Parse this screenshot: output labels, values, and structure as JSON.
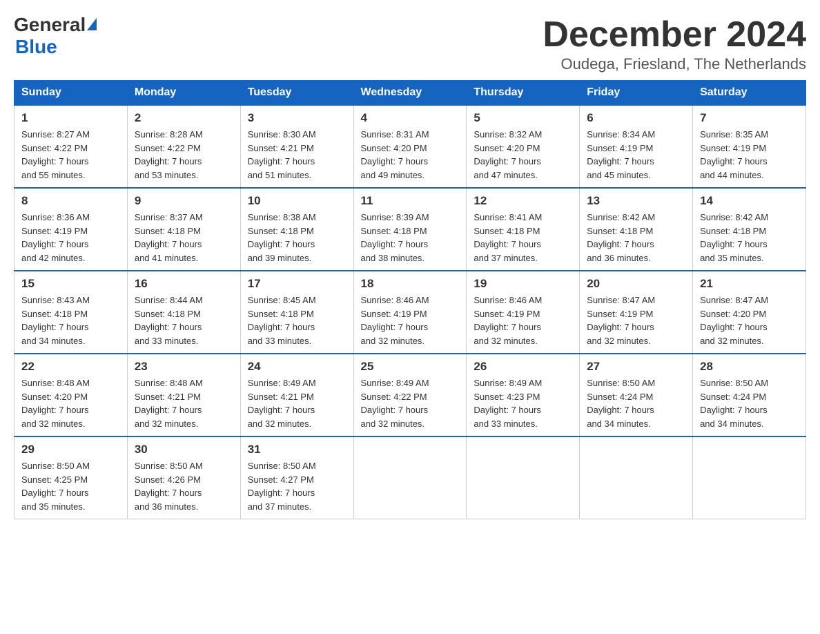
{
  "logo": {
    "text_general": "General",
    "text_blue": "Blue"
  },
  "title": "December 2024",
  "subtitle": "Oudega, Friesland, The Netherlands",
  "days_of_week": [
    "Sunday",
    "Monday",
    "Tuesday",
    "Wednesday",
    "Thursday",
    "Friday",
    "Saturday"
  ],
  "weeks": [
    [
      {
        "day": "1",
        "sunrise": "8:27 AM",
        "sunset": "4:22 PM",
        "daylight": "7 hours and 55 minutes."
      },
      {
        "day": "2",
        "sunrise": "8:28 AM",
        "sunset": "4:22 PM",
        "daylight": "7 hours and 53 minutes."
      },
      {
        "day": "3",
        "sunrise": "8:30 AM",
        "sunset": "4:21 PM",
        "daylight": "7 hours and 51 minutes."
      },
      {
        "day": "4",
        "sunrise": "8:31 AM",
        "sunset": "4:20 PM",
        "daylight": "7 hours and 49 minutes."
      },
      {
        "day": "5",
        "sunrise": "8:32 AM",
        "sunset": "4:20 PM",
        "daylight": "7 hours and 47 minutes."
      },
      {
        "day": "6",
        "sunrise": "8:34 AM",
        "sunset": "4:19 PM",
        "daylight": "7 hours and 45 minutes."
      },
      {
        "day": "7",
        "sunrise": "8:35 AM",
        "sunset": "4:19 PM",
        "daylight": "7 hours and 44 minutes."
      }
    ],
    [
      {
        "day": "8",
        "sunrise": "8:36 AM",
        "sunset": "4:19 PM",
        "daylight": "7 hours and 42 minutes."
      },
      {
        "day": "9",
        "sunrise": "8:37 AM",
        "sunset": "4:18 PM",
        "daylight": "7 hours and 41 minutes."
      },
      {
        "day": "10",
        "sunrise": "8:38 AM",
        "sunset": "4:18 PM",
        "daylight": "7 hours and 39 minutes."
      },
      {
        "day": "11",
        "sunrise": "8:39 AM",
        "sunset": "4:18 PM",
        "daylight": "7 hours and 38 minutes."
      },
      {
        "day": "12",
        "sunrise": "8:41 AM",
        "sunset": "4:18 PM",
        "daylight": "7 hours and 37 minutes."
      },
      {
        "day": "13",
        "sunrise": "8:42 AM",
        "sunset": "4:18 PM",
        "daylight": "7 hours and 36 minutes."
      },
      {
        "day": "14",
        "sunrise": "8:42 AM",
        "sunset": "4:18 PM",
        "daylight": "7 hours and 35 minutes."
      }
    ],
    [
      {
        "day": "15",
        "sunrise": "8:43 AM",
        "sunset": "4:18 PM",
        "daylight": "7 hours and 34 minutes."
      },
      {
        "day": "16",
        "sunrise": "8:44 AM",
        "sunset": "4:18 PM",
        "daylight": "7 hours and 33 minutes."
      },
      {
        "day": "17",
        "sunrise": "8:45 AM",
        "sunset": "4:18 PM",
        "daylight": "7 hours and 33 minutes."
      },
      {
        "day": "18",
        "sunrise": "8:46 AM",
        "sunset": "4:19 PM",
        "daylight": "7 hours and 32 minutes."
      },
      {
        "day": "19",
        "sunrise": "8:46 AM",
        "sunset": "4:19 PM",
        "daylight": "7 hours and 32 minutes."
      },
      {
        "day": "20",
        "sunrise": "8:47 AM",
        "sunset": "4:19 PM",
        "daylight": "7 hours and 32 minutes."
      },
      {
        "day": "21",
        "sunrise": "8:47 AM",
        "sunset": "4:20 PM",
        "daylight": "7 hours and 32 minutes."
      }
    ],
    [
      {
        "day": "22",
        "sunrise": "8:48 AM",
        "sunset": "4:20 PM",
        "daylight": "7 hours and 32 minutes."
      },
      {
        "day": "23",
        "sunrise": "8:48 AM",
        "sunset": "4:21 PM",
        "daylight": "7 hours and 32 minutes."
      },
      {
        "day": "24",
        "sunrise": "8:49 AM",
        "sunset": "4:21 PM",
        "daylight": "7 hours and 32 minutes."
      },
      {
        "day": "25",
        "sunrise": "8:49 AM",
        "sunset": "4:22 PM",
        "daylight": "7 hours and 32 minutes."
      },
      {
        "day": "26",
        "sunrise": "8:49 AM",
        "sunset": "4:23 PM",
        "daylight": "7 hours and 33 minutes."
      },
      {
        "day": "27",
        "sunrise": "8:50 AM",
        "sunset": "4:24 PM",
        "daylight": "7 hours and 34 minutes."
      },
      {
        "day": "28",
        "sunrise": "8:50 AM",
        "sunset": "4:24 PM",
        "daylight": "7 hours and 34 minutes."
      }
    ],
    [
      {
        "day": "29",
        "sunrise": "8:50 AM",
        "sunset": "4:25 PM",
        "daylight": "7 hours and 35 minutes."
      },
      {
        "day": "30",
        "sunrise": "8:50 AM",
        "sunset": "4:26 PM",
        "daylight": "7 hours and 36 minutes."
      },
      {
        "day": "31",
        "sunrise": "8:50 AM",
        "sunset": "4:27 PM",
        "daylight": "7 hours and 37 minutes."
      },
      null,
      null,
      null,
      null
    ]
  ],
  "labels": {
    "sunrise": "Sunrise:",
    "sunset": "Sunset:",
    "daylight": "Daylight:"
  }
}
